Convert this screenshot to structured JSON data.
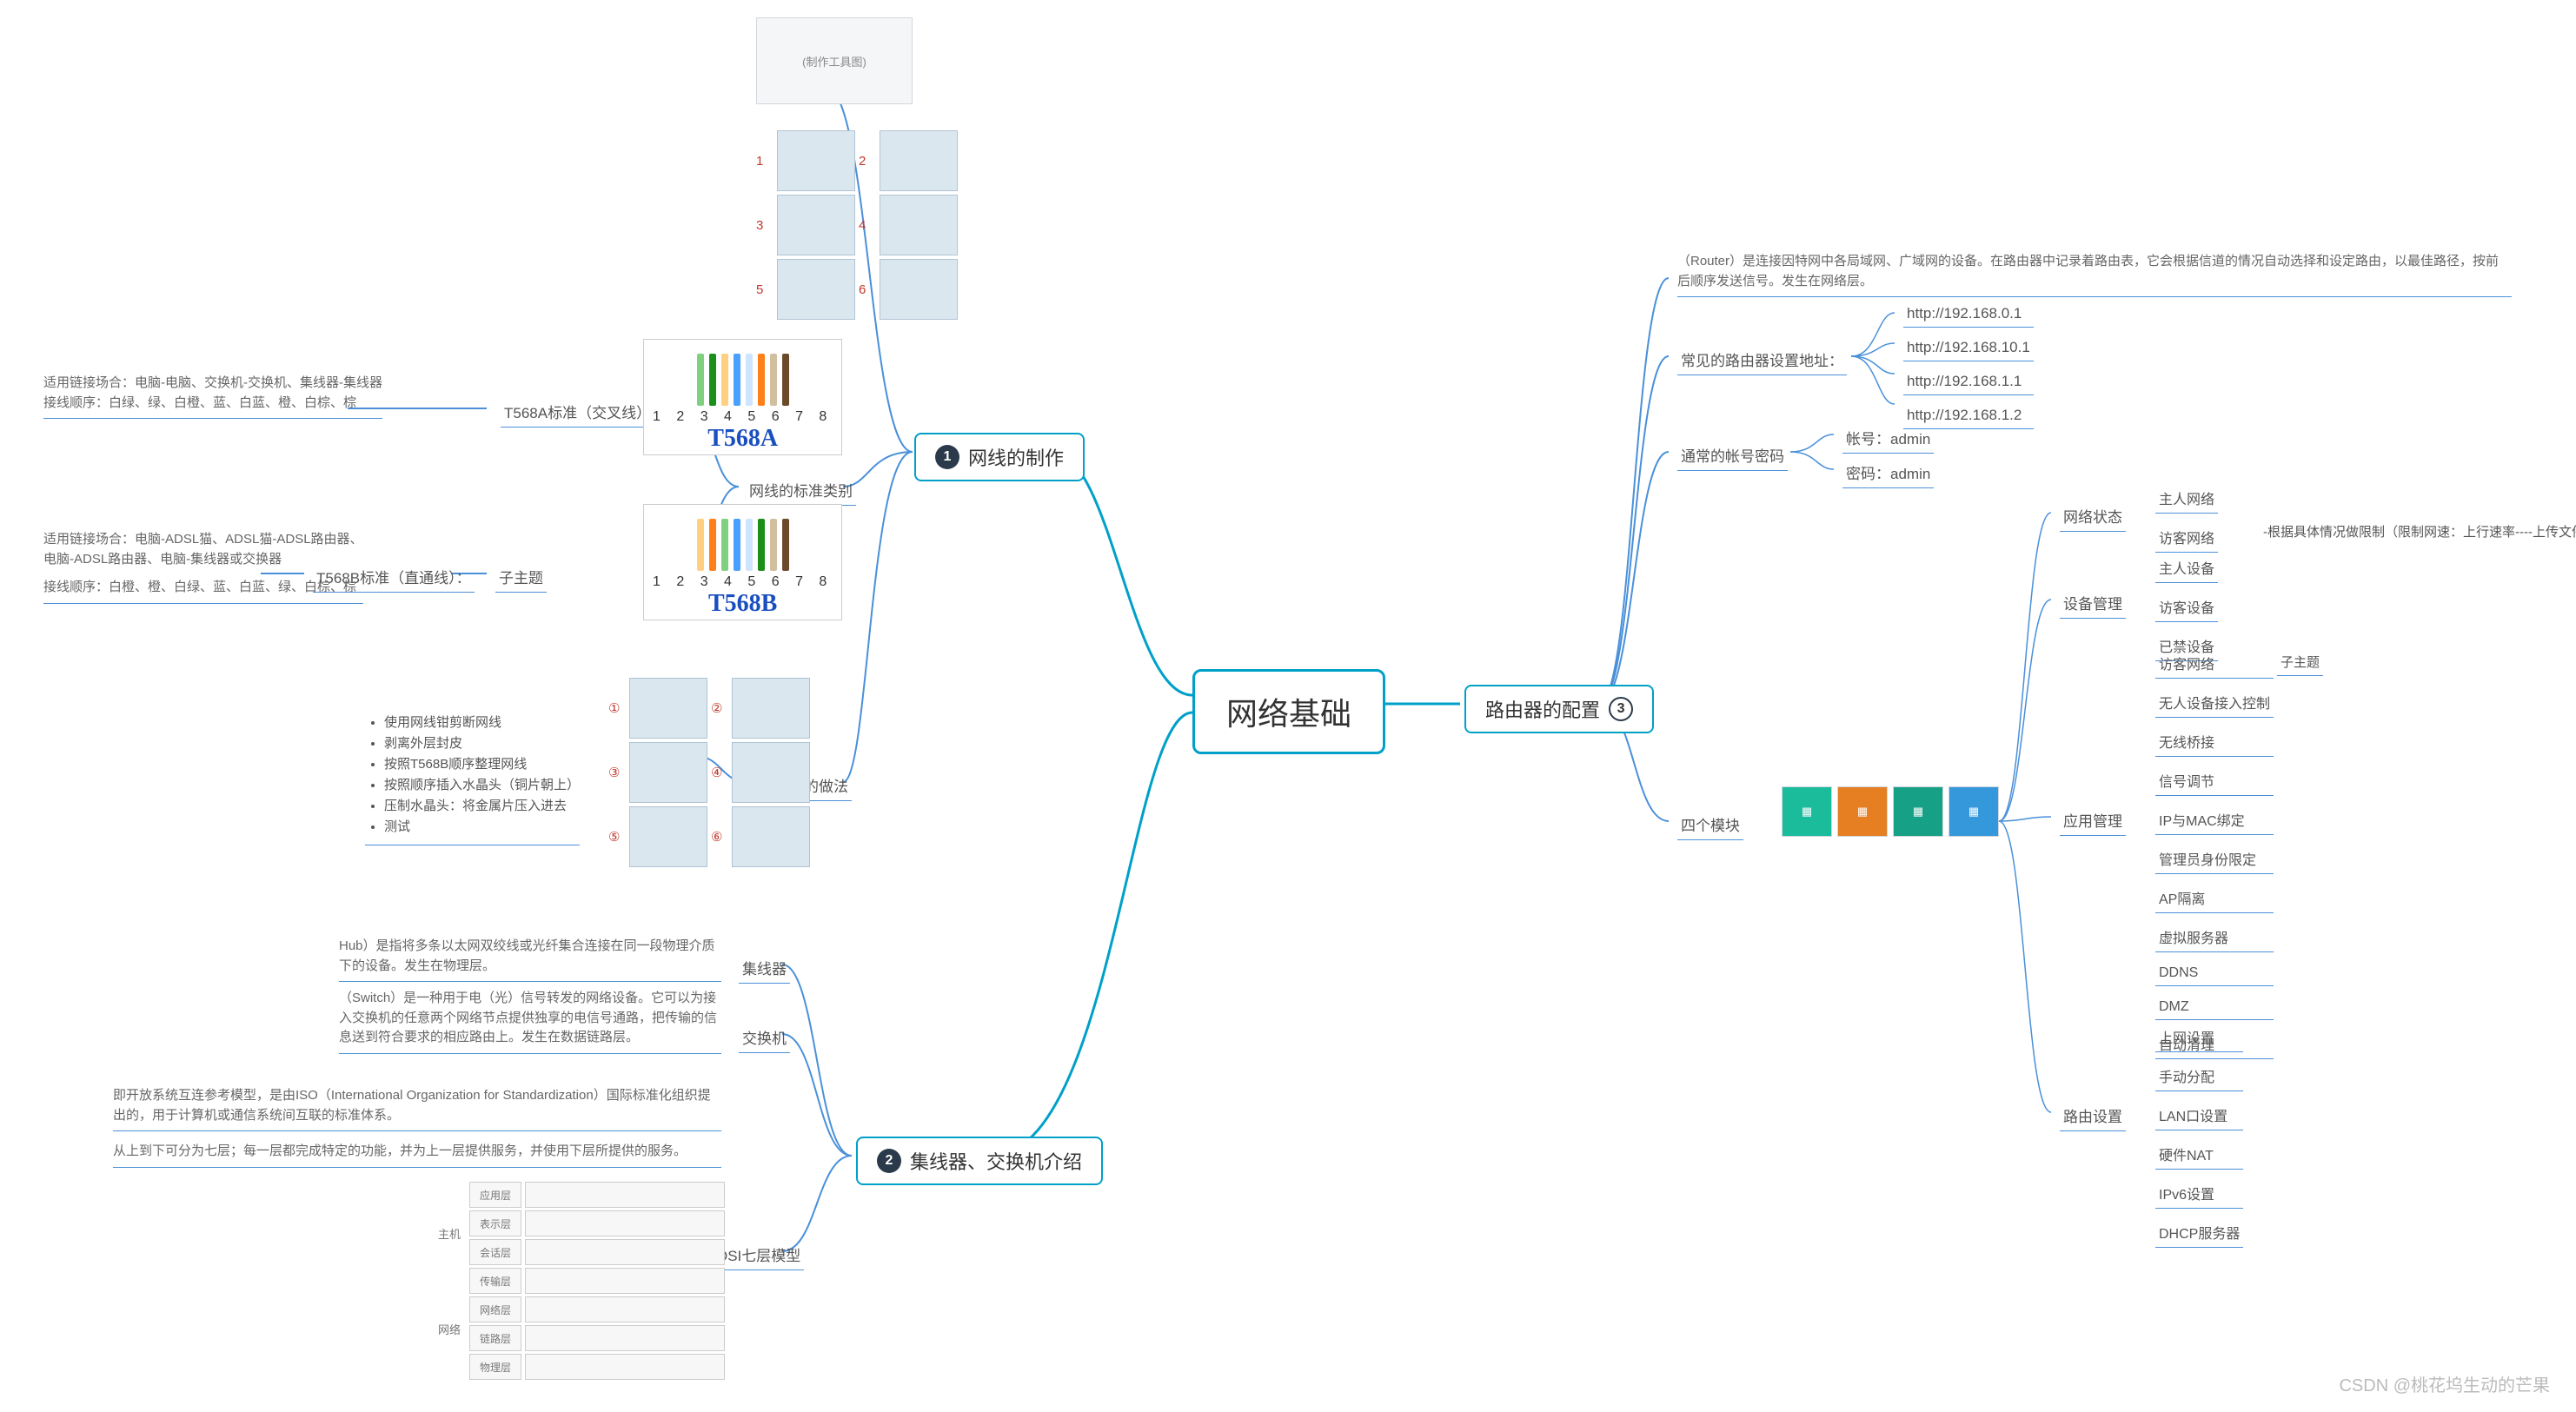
{
  "root": "网络基础",
  "branch1": {
    "num": "1",
    "label": "网线的制作"
  },
  "branch2": {
    "num": "2",
    "label": "集线器、交换机介绍"
  },
  "branch3": {
    "num": "3",
    "label": "路由器的配置"
  },
  "cable": {
    "tools_img": "(制作工具图)",
    "standard_types": "网线的标准类别",
    "t568a_label": "T568A标准（交叉线）：",
    "t568a_name": "T568A",
    "t568a_nums": "1 2 3 4 5 6 7 8",
    "t568a_note_l1": "适用链接场合：电脑-电脑、交换机-交换机、集线器-集线器",
    "t568a_note_l2": "接线顺序：白绿、绿、白橙、蓝、白蓝、橙、白棕、棕",
    "t568a_colors": [
      "#7fd07f",
      "#1a8f1a",
      "#ffd080",
      "#4aa0ff",
      "#cfe4ff",
      "#ff7f1a",
      "#d0c0a0",
      "#6b4a2a"
    ],
    "sub_topic": "子主题",
    "t568b_label": "T568B标准（直通线）：",
    "t568b_name": "T568B",
    "t568b_nums": "1 2 3 4 5 6 7 8",
    "t568b_note_l1": "适用链接场合：电脑-ADSL猫、ADSL猫-ADSL路由器、",
    "t568b_note_l2": "电脑-ADSL路由器、电脑-集线器或交换器",
    "t568b_note_l3": "接线顺序：白橙、橙、白绿、蓝、白蓝、绿、白棕、棕",
    "t568b_colors": [
      "#ffd080",
      "#ff7f1a",
      "#7fd07f",
      "#4aa0ff",
      "#cfe4ff",
      "#1a8f1a",
      "#d0c0a0",
      "#6b4a2a"
    ],
    "crystal_label": "水晶头的做法",
    "crystal_steps": [
      "使用网线钳剪断网线",
      "剥离外层封皮",
      "按照T568B顺序整理网线",
      "按照顺序插入水晶头（铜片朝上）",
      "压制水晶头：将金属片压入进去",
      "测试"
    ]
  },
  "hub": {
    "hub_label": "集线器",
    "hub_desc": "Hub）是指将多条以太网双绞线或光纤集合连接在同一段物理介质下的设备。发生在物理层。",
    "switch_label": "交换机",
    "switch_desc": "（Switch）是一种用于电（光）信号转发的网络设备。它可以为接入交换机的任意两个网络节点提供独享的电信号通路，把传输的信息送到符合要求的相应路由上。发生在数据链路层。",
    "osi_label": "OSI七层模型",
    "osi_desc1": "即开放系统互连参考模型，是由ISO（International Organization for Standardization）国际标准化组织提出的，用于计算机或通信系统间互联的标准体系。",
    "osi_desc2": "从上到下可分为七层；每一层都完成特定的功能，并为上一层提供服务，并使用下层所提供的服务。",
    "osi_layers": [
      "应用层",
      "表示层",
      "会话层",
      "传输层",
      "网络层",
      "链路层",
      "物理层"
    ],
    "osi_side_top": "主机",
    "osi_side_bot": "网络"
  },
  "router": {
    "desc": "（Router）是连接因特网中各局域网、广域网的设备。在路由器中记录着路由表，它会根据信道的情况自动选择和设定路由，以最佳路径，按前后顺序发送信号。发生在网络层。",
    "addr_label": "常见的路由器设置地址：",
    "addrs": [
      "http://192.168.0.1",
      "http://192.168.10.1",
      "http://192.168.1.1",
      "http://192.168.1.2"
    ],
    "cred_label": "通常的帐号密码",
    "cred_user_k": "帐号：",
    "cred_user_v": "admin",
    "cred_pass_k": "密码：",
    "cred_pass_v": "admin",
    "modules_label": "四个模块",
    "net_status": {
      "label": "网络状态",
      "items": [
        "主人网络",
        "访客网络"
      ],
      "guest_note": "-根据具体情况做限制（限制网速：上行速率----上传文件...下行速率：看视频...）"
    },
    "dev_mgmt": {
      "label": "设备管理",
      "items": [
        "主人设备",
        "访客设备",
        "已禁设备"
      ]
    },
    "app_mgmt": {
      "label": "应用管理",
      "items": [
        "访客网络",
        "无人设备接入控制",
        "无线桥接",
        "信号调节",
        "IP与MAC绑定",
        "管理员身份限定",
        "AP隔离",
        "虚拟服务器",
        "DDNS",
        "DMZ",
        "自动清理"
      ],
      "sub": "子主题"
    },
    "route_set": {
      "label": "路由设置",
      "items": [
        "上网设置",
        "手动分配",
        "LAN口设置",
        "硬件NAT",
        "IPv6设置",
        "DHCP服务器"
      ]
    },
    "icons_ph": "(四模块图标)"
  },
  "watermark": "CSDN @桃花坞生动的芒果"
}
